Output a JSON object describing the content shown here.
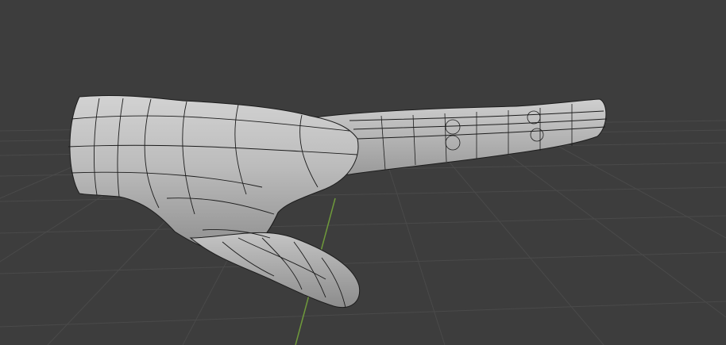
{
  "viewport": {
    "background": "#3d3d3d",
    "grid_color": "#4a4a4a",
    "y_axis_color": "#6f9a3b",
    "mesh_fill": "#bdbdbd",
    "wire_color": "#1c1c1c",
    "object": "hand-mesh"
  }
}
